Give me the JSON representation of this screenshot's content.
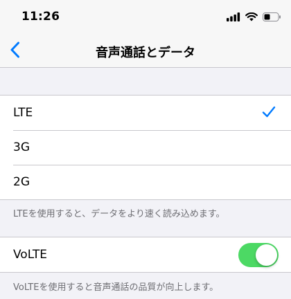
{
  "status_bar": {
    "time": "11:26",
    "icons": [
      "cellular-signal-icon",
      "wifi-icon",
      "battery-icon"
    ]
  },
  "nav": {
    "back_icon": "chevron-left-icon",
    "title": "音声通話とデータ"
  },
  "network_options": [
    {
      "label": "LTE",
      "selected": true
    },
    {
      "label": "3G",
      "selected": false
    },
    {
      "label": "2G",
      "selected": false
    }
  ],
  "network_footnote": "LTEを使用すると、データをより速く読み込めます。",
  "volte": {
    "label": "VoLTE",
    "enabled": true,
    "footnote": "VoLTEを使用すると音声通話の品質が向上します。"
  },
  "colors": {
    "accent": "#007aff",
    "toggle_on": "#4cd964",
    "background": "#f2f2f7"
  }
}
